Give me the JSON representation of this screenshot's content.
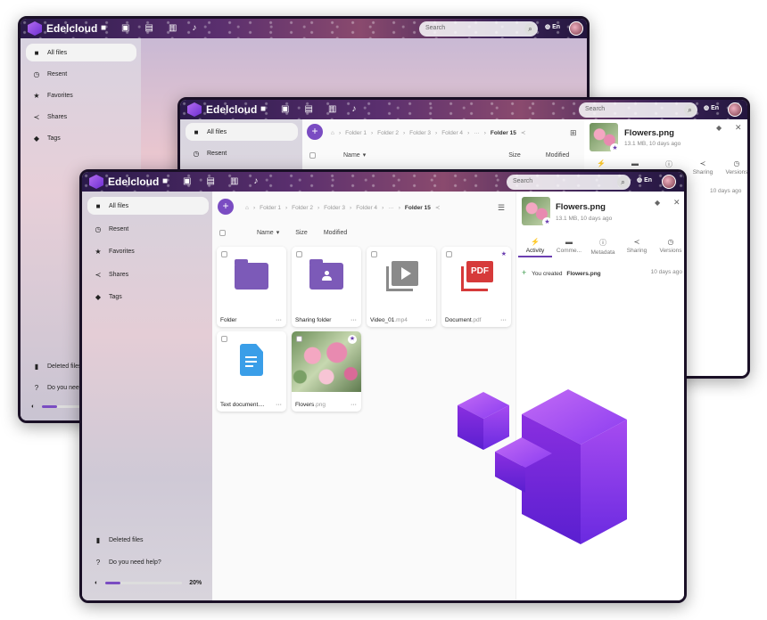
{
  "app": {
    "name": "Edelcloud",
    "lang": "En"
  },
  "search": {
    "placeholder": "Search"
  },
  "sidebar": {
    "items": [
      {
        "label": "All files",
        "icon": "folder-icon"
      },
      {
        "label": "Resent",
        "icon": "clock-icon"
      },
      {
        "label": "Favorites",
        "icon": "star-icon"
      },
      {
        "label": "Shares",
        "icon": "share-icon"
      },
      {
        "label": "Tags",
        "icon": "tag-icon"
      }
    ],
    "bottom": [
      {
        "label": "Deleted files",
        "icon": "trash-icon"
      },
      {
        "label": "Do you need help?",
        "icon": "help-icon"
      }
    ],
    "bottom_truncated": "Do you need h",
    "quota": {
      "percent": 20,
      "label": "20%"
    }
  },
  "breadcrumb": [
    "Folder 1",
    "Folder 2",
    "Folder 3",
    "Folder 4",
    "···",
    "Folder 15"
  ],
  "columns": {
    "name": "Name",
    "size": "Size",
    "modified": "Modified"
  },
  "files": [
    {
      "name": "Folder",
      "ext": "",
      "type": "folder",
      "starred": false
    },
    {
      "name": "Sharing folder",
      "ext": "",
      "type": "shared-folder",
      "starred": false
    },
    {
      "name": "Video_01",
      "ext": ".mp4",
      "type": "video",
      "starred": false
    },
    {
      "name": "Document",
      "ext": ".pdf",
      "type": "pdf",
      "starred": true
    },
    {
      "name": "Text document....",
      "ext": "",
      "type": "text",
      "starred": false
    },
    {
      "name": "Flovers",
      "ext": ".png",
      "type": "image",
      "starred": true
    }
  ],
  "pdf_badge": "PDF",
  "details": {
    "title": "Flowers.png",
    "meta": "13.1 MB, 10 days ago",
    "tabs": [
      "Activity",
      "Comme...",
      "Metadata",
      "Sharing",
      "Versions"
    ],
    "activity": {
      "text": "You created",
      "file": "Flowers.png",
      "time": "10 days ago"
    }
  },
  "colors": {
    "accent": "#7a4cc2",
    "pdf": "#d63a3a",
    "text_doc": "#3a9ee8"
  }
}
